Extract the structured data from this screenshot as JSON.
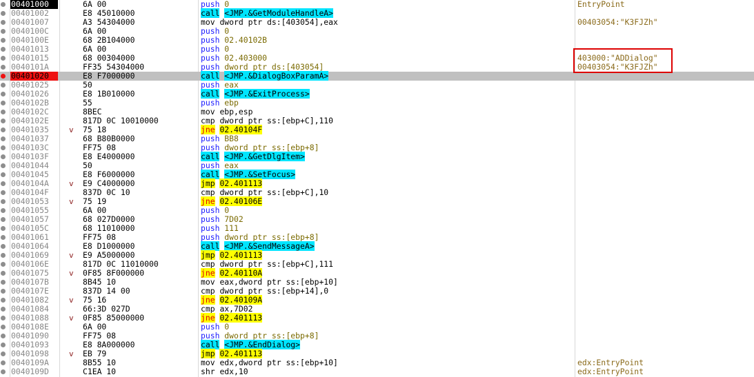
{
  "rows": [
    {
      "addr": "00401000",
      "hex": "6A 00",
      "arrow": "",
      "mn": "push",
      "op": "0",
      "cmt": "EntryPoint",
      "state": "current"
    },
    {
      "addr": "00401002",
      "hex": "E8 45010000",
      "arrow": "",
      "mn": "call",
      "op": "<JMP.&GetModuleHandleA>",
      "cmt": "",
      "state": ""
    },
    {
      "addr": "00401007",
      "hex": "A3 54304000",
      "arrow": "",
      "mn": "mov",
      "op": "dword ptr ds:[403054],eax",
      "cmt": "00403054:\"K3FJZh\"",
      "state": ""
    },
    {
      "addr": "0040100C",
      "hex": "6A 00",
      "arrow": "",
      "mn": "push",
      "op": "0",
      "cmt": "",
      "state": ""
    },
    {
      "addr": "0040100E",
      "hex": "68 2B104000",
      "arrow": "",
      "mn": "push",
      "op": "02.40102B",
      "cmt": "",
      "state": ""
    },
    {
      "addr": "00401013",
      "hex": "6A 00",
      "arrow": "",
      "mn": "push",
      "op": "0",
      "cmt": "",
      "state": ""
    },
    {
      "addr": "00401015",
      "hex": "68 00304000",
      "arrow": "",
      "mn": "push",
      "op": "02.403000",
      "cmt": "403000:\"ADDialog\"",
      "state": ""
    },
    {
      "addr": "0040101A",
      "hex": "FF35 54304000",
      "arrow": "",
      "mn": "push",
      "op": "dword ptr ds:[403054]",
      "cmt": "00403054:\"K3FJZh\"",
      "state": ""
    },
    {
      "addr": "00401020",
      "hex": "E8 F7000000",
      "arrow": "",
      "mn": "call",
      "op": "<JMP.&DialogBoxParamA>",
      "cmt": "",
      "state": "breakpoint"
    },
    {
      "addr": "00401025",
      "hex": "50",
      "arrow": "",
      "mn": "push",
      "op": "eax",
      "cmt": "",
      "state": ""
    },
    {
      "addr": "00401026",
      "hex": "E8 1B010000",
      "arrow": "",
      "mn": "call",
      "op": "<JMP.&ExitProcess>",
      "cmt": "",
      "state": ""
    },
    {
      "addr": "0040102B",
      "hex": "55",
      "arrow": "",
      "mn": "push",
      "op": "ebp",
      "cmt": "",
      "state": ""
    },
    {
      "addr": "0040102C",
      "hex": "8BEC",
      "arrow": "",
      "mn": "mov",
      "op": "ebp,esp",
      "cmt": "",
      "state": ""
    },
    {
      "addr": "0040102E",
      "hex": "817D 0C 10010000",
      "arrow": "",
      "mn": "cmp",
      "op": "dword ptr ss:[ebp+C],110",
      "cmt": "",
      "state": ""
    },
    {
      "addr": "00401035",
      "hex": "75 18",
      "arrow": "v",
      "mn": "jne",
      "op": "02.40104F",
      "cmt": "",
      "state": ""
    },
    {
      "addr": "00401037",
      "hex": "68 B80B0000",
      "arrow": "",
      "mn": "push",
      "op": "BB8",
      "cmt": "",
      "state": ""
    },
    {
      "addr": "0040103C",
      "hex": "FF75 08",
      "arrow": "",
      "mn": "push",
      "op": "dword ptr ss:[ebp+8]",
      "cmt": "",
      "state": ""
    },
    {
      "addr": "0040103F",
      "hex": "E8 E4000000",
      "arrow": "",
      "mn": "call",
      "op": "<JMP.&GetDlgItem>",
      "cmt": "",
      "state": ""
    },
    {
      "addr": "00401044",
      "hex": "50",
      "arrow": "",
      "mn": "push",
      "op": "eax",
      "cmt": "",
      "state": ""
    },
    {
      "addr": "00401045",
      "hex": "E8 F6000000",
      "arrow": "",
      "mn": "call",
      "op": "<JMP.&SetFocus>",
      "cmt": "",
      "state": ""
    },
    {
      "addr": "0040104A",
      "hex": "E9 C4000000",
      "arrow": "v",
      "mn": "jmp",
      "op": "02.401113",
      "cmt": "",
      "state": ""
    },
    {
      "addr": "0040104F",
      "hex": "837D 0C 10",
      "arrow": "",
      "mn": "cmp",
      "op": "dword ptr ss:[ebp+C],10",
      "cmt": "",
      "state": ""
    },
    {
      "addr": "00401053",
      "hex": "75 19",
      "arrow": "v",
      "mn": "jne",
      "op": "02.40106E",
      "cmt": "",
      "state": ""
    },
    {
      "addr": "00401055",
      "hex": "6A 00",
      "arrow": "",
      "mn": "push",
      "op": "0",
      "cmt": "",
      "state": ""
    },
    {
      "addr": "00401057",
      "hex": "68 027D0000",
      "arrow": "",
      "mn": "push",
      "op": "7D02",
      "cmt": "",
      "state": ""
    },
    {
      "addr": "0040105C",
      "hex": "68 11010000",
      "arrow": "",
      "mn": "push",
      "op": "111",
      "cmt": "",
      "state": ""
    },
    {
      "addr": "00401061",
      "hex": "FF75 08",
      "arrow": "",
      "mn": "push",
      "op": "dword ptr ss:[ebp+8]",
      "cmt": "",
      "state": ""
    },
    {
      "addr": "00401064",
      "hex": "E8 D1000000",
      "arrow": "",
      "mn": "call",
      "op": "<JMP.&SendMessageA>",
      "cmt": "",
      "state": ""
    },
    {
      "addr": "00401069",
      "hex": "E9 A5000000",
      "arrow": "v",
      "mn": "jmp",
      "op": "02.401113",
      "cmt": "",
      "state": ""
    },
    {
      "addr": "0040106E",
      "hex": "817D 0C 11010000",
      "arrow": "",
      "mn": "cmp",
      "op": "dword ptr ss:[ebp+C],111",
      "cmt": "",
      "state": ""
    },
    {
      "addr": "00401075",
      "hex": "0F85 8F000000",
      "arrow": "v",
      "mn": "jne",
      "op": "02.40110A",
      "cmt": "",
      "state": ""
    },
    {
      "addr": "0040107B",
      "hex": "8B45 10",
      "arrow": "",
      "mn": "mov",
      "op": "eax,dword ptr ss:[ebp+10]",
      "cmt": "",
      "state": ""
    },
    {
      "addr": "0040107E",
      "hex": "837D 14 00",
      "arrow": "",
      "mn": "cmp",
      "op": "dword ptr ss:[ebp+14],0",
      "cmt": "",
      "state": ""
    },
    {
      "addr": "00401082",
      "hex": "75 16",
      "arrow": "v",
      "mn": "jne",
      "op": "02.40109A",
      "cmt": "",
      "state": ""
    },
    {
      "addr": "00401084",
      "hex": "66:3D 027D",
      "arrow": "",
      "mn": "cmp",
      "op": "ax,7D02",
      "cmt": "",
      "state": ""
    },
    {
      "addr": "00401088",
      "hex": "0F85 85000000",
      "arrow": "v",
      "mn": "jne",
      "op": "02.401113",
      "cmt": "",
      "state": ""
    },
    {
      "addr": "0040108E",
      "hex": "6A 00",
      "arrow": "",
      "mn": "push",
      "op": "0",
      "cmt": "",
      "state": ""
    },
    {
      "addr": "00401090",
      "hex": "FF75 08",
      "arrow": "",
      "mn": "push",
      "op": "dword ptr ss:[ebp+8]",
      "cmt": "",
      "state": ""
    },
    {
      "addr": "00401093",
      "hex": "E8 8A000000",
      "arrow": "",
      "mn": "call",
      "op": "<JMP.&EndDialog>",
      "cmt": "",
      "state": ""
    },
    {
      "addr": "00401098",
      "hex": "EB 79",
      "arrow": "v",
      "mn": "jmp",
      "op": "02.401113",
      "cmt": "",
      "state": ""
    },
    {
      "addr": "0040109A",
      "hex": "8B55 10",
      "arrow": "",
      "mn": "mov",
      "op": "edx,dword ptr ss:[ebp+10]",
      "cmt": "edx:EntryPoint",
      "state": ""
    },
    {
      "addr": "0040109D",
      "hex": "C1EA 10",
      "arrow": "",
      "mn": "shr",
      "op": "edx,10",
      "cmt": "edx:EntryPoint",
      "state": ""
    }
  ],
  "colors": {
    "call_bg": "#00e5ff",
    "jump_bg": "#ffff00",
    "jne_text": "#e00000",
    "breakpoint": "#ee1111",
    "selected_row": "#c0c0c0",
    "comment_text": "#8a6a1a",
    "highlight_box": "#dd0000"
  }
}
